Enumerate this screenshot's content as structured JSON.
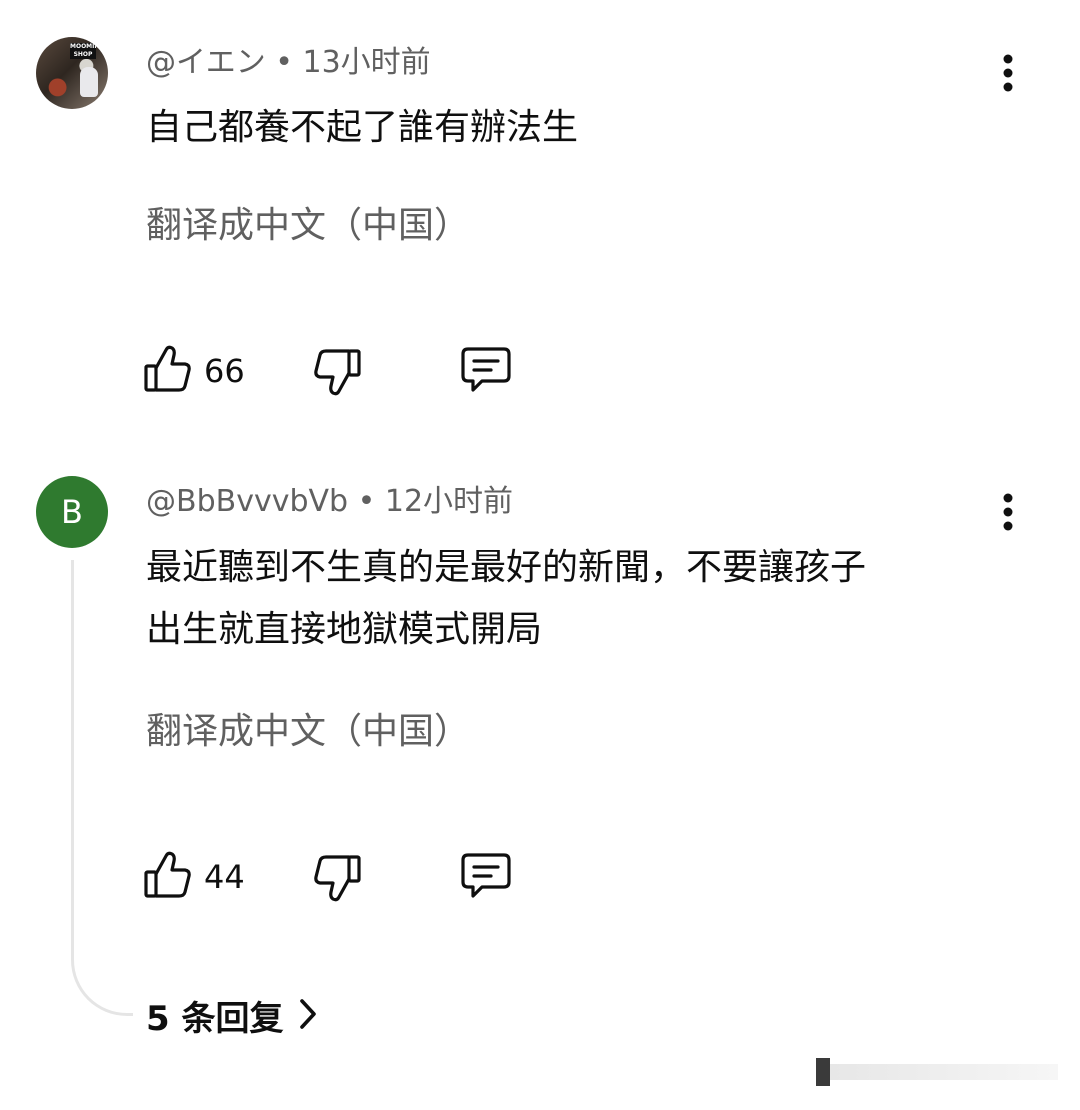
{
  "comments": [
    {
      "author": "@イエン",
      "time": "13小时前",
      "separator": "•",
      "text": "自己都養不起了誰有辦法生",
      "translate_label": "翻译成中文（中国）",
      "likes": "66",
      "avatar": {
        "type": "photo",
        "sign_text": "MOOMIN SHOP"
      },
      "icons": [
        "thumb-up-icon",
        "thumb-down-icon",
        "reply-icon",
        "more-vert-icon"
      ]
    },
    {
      "author": "@BbBvvvbVb",
      "time": "12小时前",
      "separator": "•",
      "text_lines": [
        "最近聽到不生真的是最好的新聞，不要讓孩子",
        "出生就直接地獄模式開局"
      ],
      "translate_label": "翻译成中文（中国）",
      "likes": "44",
      "avatar": {
        "type": "letter",
        "letter": "B",
        "color": "#2f7a2f"
      },
      "icons": [
        "thumb-up-icon",
        "thumb-down-icon",
        "reply-icon",
        "more-vert-icon"
      ]
    }
  ],
  "replies": {
    "label": "5 条回复",
    "icon": "chevron-right-icon"
  },
  "colors": {
    "text_primary": "#0f0f0f",
    "text_secondary": "#606060",
    "thread_line": "#e5e5e5"
  }
}
